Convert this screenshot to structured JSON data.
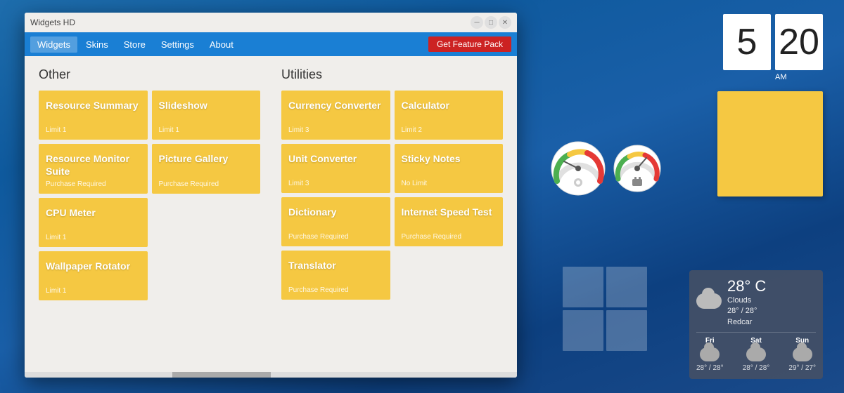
{
  "desktop": {
    "clock": {
      "hour": "5",
      "minute": "20",
      "period": "AM"
    },
    "weather": {
      "temp": "28° C",
      "condition": "Clouds",
      "range": "28° / 28°",
      "location": "Redcar",
      "forecast": [
        {
          "day": "Fri",
          "temps": "28° / 28°"
        },
        {
          "day": "Sat",
          "temps": "28° / 28°"
        },
        {
          "day": "Sun",
          "temps": "29° / 27°"
        }
      ]
    }
  },
  "app": {
    "title": "Widgets HD",
    "menu": {
      "items": [
        "Widgets",
        "Skins",
        "Store",
        "Settings",
        "About"
      ],
      "active_index": 0,
      "feature_button": "Get Feature Pack"
    },
    "sections": {
      "other": {
        "title": "Other",
        "widgets": [
          {
            "name": "Resource Summary",
            "limit": "Limit 1"
          },
          {
            "name": "Slideshow",
            "limit": "Limit 1"
          },
          {
            "name": "Resource Monitor Suite",
            "limit": "Purchase Required"
          },
          {
            "name": "Picture Gallery",
            "limit": "Purchase Required"
          },
          {
            "name": "CPU Meter",
            "limit": "Limit 1"
          },
          {
            "name": "Wallpaper Rotator",
            "limit": "Limit 1"
          }
        ]
      },
      "utilities": {
        "title": "Utilities",
        "widgets": [
          {
            "name": "Currency Converter",
            "limit": "Limit 3"
          },
          {
            "name": "Calculator",
            "limit": "Limit 2"
          },
          {
            "name": "Unit Converter",
            "limit": "Limit 3"
          },
          {
            "name": "Sticky Notes",
            "limit": "No Limit"
          },
          {
            "name": "Dictionary",
            "limit": "Purchase Required"
          },
          {
            "name": "Internet Speed Test",
            "limit": "Purchase Required"
          },
          {
            "name": "Translator",
            "limit": "Purchase Required"
          }
        ]
      }
    }
  }
}
